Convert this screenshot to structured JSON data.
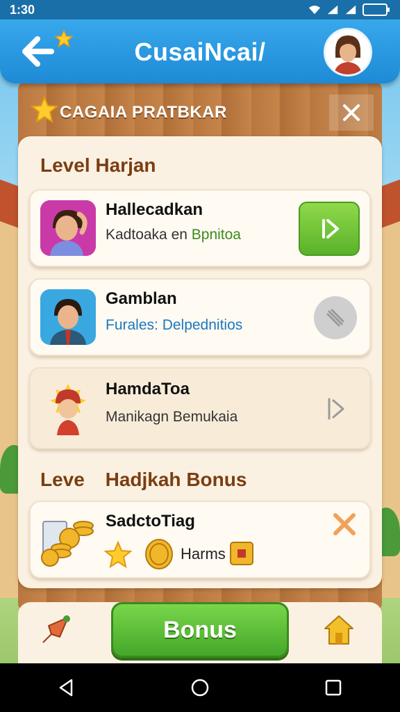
{
  "status_bar": {
    "time": "1:30"
  },
  "header": {
    "title": "CusaiNcai/"
  },
  "panel": {
    "title": "CAGAIA PRATBKAR"
  },
  "sections": {
    "level_title": "Level Harjan",
    "bonus_title_a": "Leve",
    "bonus_title_b": "Hadjkah Bonus"
  },
  "rows": [
    {
      "title": "Hallecadkan",
      "subtitle_a": "Kadtoaka en ",
      "subtitle_b": "Bpnitoa"
    },
    {
      "title": "Gamblan",
      "subtitle": "Furales: Delpednitios"
    },
    {
      "title": "HamdaToa",
      "subtitle": "Manikagn Bemukaia"
    }
  ],
  "bonus_row": {
    "title": "SadctoTiag",
    "item_label": "Harms"
  },
  "bottom_bar": {
    "bonus_label": "Bonus"
  },
  "colors": {
    "header_blue": "#1e8ad6",
    "accent_green": "#5ab22a",
    "section_brown": "#7a3e12",
    "subtitle_blue": "#1a78c2"
  },
  "icons": [
    "back-arrow-icon",
    "star-icon",
    "user-avatar",
    "close-icon",
    "play-icon",
    "disabled-icon",
    "chevron-right-icon",
    "coin-stack-icon",
    "coin-icon",
    "ticket-icon",
    "rocket-icon",
    "home-icon"
  ]
}
